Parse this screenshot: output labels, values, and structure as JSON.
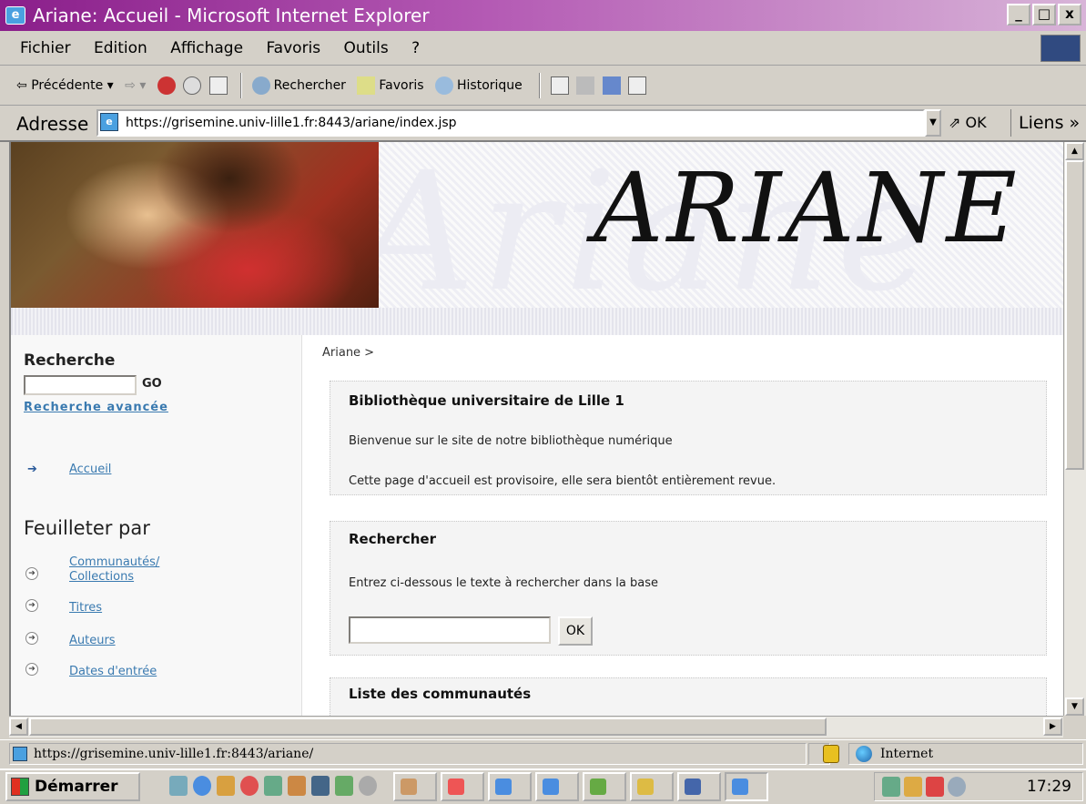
{
  "window": {
    "title": "Ariane: Accueil - Microsoft Internet Explorer",
    "controls": [
      "_",
      "□",
      "x"
    ]
  },
  "menu": [
    "Fichier",
    "Edition",
    "Affichage",
    "Favoris",
    "Outils",
    "?"
  ],
  "toolbar": {
    "back": "Précédente",
    "search": "Rechercher",
    "favorites": "Favoris",
    "history": "Historique"
  },
  "address": {
    "label": "Adresse",
    "url": "https://grisemine.univ-lille1.fr:8443/ariane/index.jsp",
    "go": "OK",
    "links": "Liens"
  },
  "banner": {
    "title": "ARIANE",
    "bg_word": "Ariane"
  },
  "sidebar": {
    "search_title": "Recherche",
    "go": "GO",
    "advanced": "Recherche avancée",
    "home": "Accueil",
    "browse_title": "Feuilleter par",
    "browse_items": [
      {
        "label": "Communautés/ Collections"
      },
      {
        "label": "Titres"
      },
      {
        "label": "Auteurs"
      },
      {
        "label": "Dates d'entrée"
      }
    ]
  },
  "main": {
    "breadcrumb": "Ariane >",
    "library_box": {
      "title": "Bibliothèque universitaire de Lille 1",
      "welcome": "Bienvenue sur le site de notre bibliothèque numérique",
      "note": "Cette page d'accueil est provisoire, elle sera bientôt entièrement revue."
    },
    "search_box": {
      "title": "Rechercher",
      "hint": "Entrez ci-dessous le texte à rechercher dans la base",
      "ok": "OK"
    },
    "communities_box": {
      "title": "Liste des communautés"
    }
  },
  "status": {
    "url": "https://grisemine.univ-lille1.fr:8443/ariane/",
    "zone": "Internet"
  },
  "taskbar": {
    "start": "Démarrer",
    "clock": "17:29"
  }
}
